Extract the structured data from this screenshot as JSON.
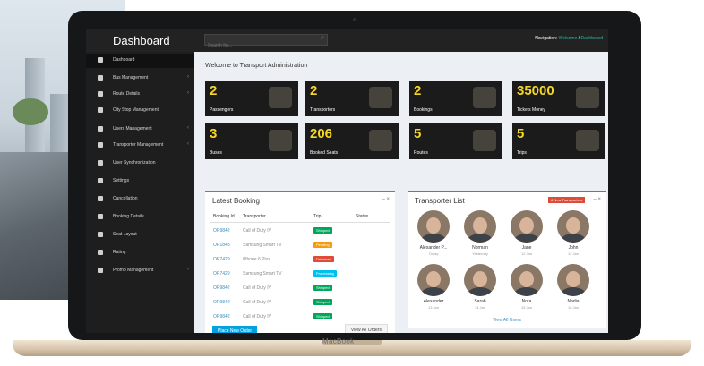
{
  "device": {
    "brand": "MacBook"
  },
  "header": {
    "app_title": "Dashboard",
    "search_placeholder": "Search for...",
    "nav_label": "Navigation:",
    "nav_user": "Welcome",
    "nav_separator": "/",
    "nav_current": "Dashboard"
  },
  "sidebar": {
    "items": [
      {
        "label": "Dashboard",
        "icon": "dashboard-icon",
        "active": true,
        "has_children": false
      },
      {
        "label": "Bus Management",
        "icon": "bus-icon",
        "active": false,
        "has_children": true
      },
      {
        "label": "Route Details",
        "icon": "route-icon",
        "active": false,
        "has_children": true
      },
      {
        "label": "City Stop Management",
        "icon": "stop-icon",
        "active": false,
        "has_children": false
      },
      {
        "label": "Users Management",
        "icon": "users-icon",
        "active": false,
        "has_children": true
      },
      {
        "label": "Transporter Management",
        "icon": "transporter-icon",
        "active": false,
        "has_children": true
      },
      {
        "label": "User Synchronization",
        "icon": "sync-icon",
        "active": false,
        "has_children": false
      },
      {
        "label": "Settings",
        "icon": "gear-icon",
        "active": false,
        "has_children": false
      },
      {
        "label": "Cancellation",
        "icon": "cancel-icon",
        "active": false,
        "has_children": false
      },
      {
        "label": "Booking Details",
        "icon": "booking-icon",
        "active": false,
        "has_children": false
      },
      {
        "label": "Seat Layout",
        "icon": "seat-icon",
        "active": false,
        "has_children": false
      },
      {
        "label": "Rating",
        "icon": "star-icon",
        "active": false,
        "has_children": false
      },
      {
        "label": "Promo Management",
        "icon": "promo-icon",
        "active": false,
        "has_children": true
      }
    ]
  },
  "content": {
    "welcome": "Welcome to Transport Administration",
    "cards": [
      {
        "value": "2",
        "label": "Passengers",
        "icon": "users-icon"
      },
      {
        "value": "2",
        "label": "Transporters",
        "icon": "users-icon"
      },
      {
        "value": "2",
        "label": "Bookings",
        "icon": "calendar-icon"
      },
      {
        "value": "35000",
        "label": "Tickets Money",
        "icon": "money-icon"
      },
      {
        "value": "3",
        "label": "Buses",
        "icon": "bus-icon"
      },
      {
        "value": "206",
        "label": "Booked Seats",
        "icon": "seat-icon"
      },
      {
        "value": "5",
        "label": "Routes",
        "icon": "map-marker-icon"
      },
      {
        "value": "5",
        "label": "Trips",
        "icon": "road-icon"
      }
    ],
    "latest_booking": {
      "title": "Latest Booking",
      "columns": [
        "Booking Id",
        "Transporter",
        "Trip",
        "Status"
      ],
      "rows": [
        {
          "id": "OR9842",
          "transporter": "Call of Duty IV",
          "status": "Shipped",
          "status_color": "#00a65a"
        },
        {
          "id": "OR1848",
          "transporter": "Samsung Smart TV",
          "status": "Pending",
          "status_color": "#f39c12"
        },
        {
          "id": "OR7429",
          "transporter": "iPhone 6 Plus",
          "status": "Delivered",
          "status_color": "#dd4b39"
        },
        {
          "id": "OR7429",
          "transporter": "Samsung Smart TV",
          "status": "Processing",
          "status_color": "#00c0ef"
        },
        {
          "id": "OR9842",
          "transporter": "Call of Duty IV",
          "status": "Shipped",
          "status_color": "#00a65a"
        },
        {
          "id": "OR9842",
          "transporter": "Call of Duty IV",
          "status": "Shipped",
          "status_color": "#00a65a"
        },
        {
          "id": "OR9842",
          "transporter": "Call of Duty IV",
          "status": "Shipped",
          "status_color": "#00a65a"
        }
      ],
      "place_order": "Place New Order",
      "view_all": "View All Orders"
    },
    "transporter_list": {
      "title": "Transporter List",
      "badge": "8 New Transporters",
      "users": [
        {
          "name": "Alexander P...",
          "date": "Today"
        },
        {
          "name": "Norman",
          "date": "Yesterday"
        },
        {
          "name": "Jane",
          "date": "12 Jan"
        },
        {
          "name": "John",
          "date": "12 Jan"
        },
        {
          "name": "Alexander",
          "date": "13 Jan"
        },
        {
          "name": "Sarah",
          "date": "14 Jan"
        },
        {
          "name": "Nora",
          "date": "15 Jan"
        },
        {
          "name": "Nadia",
          "date": "15 Jan"
        }
      ],
      "view_all": "View All Users"
    }
  }
}
